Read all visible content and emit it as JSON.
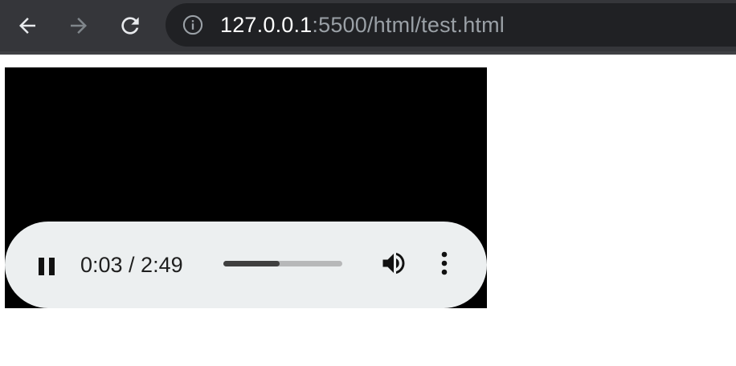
{
  "browser": {
    "nav": {
      "back_icon": "arrow-left-icon",
      "forward_icon": "arrow-right-icon",
      "reload_icon": "reload-icon"
    },
    "address_bar": {
      "info_icon": "info-icon",
      "url_host": "127.0.0.1",
      "url_rest": ":5500/html/test.html"
    }
  },
  "video_player": {
    "state": "playing",
    "pause_icon": "pause-icon",
    "time_display": "0:03 / 2:49",
    "current_time": "0:03",
    "duration": "2:49",
    "progress_fraction": 0.47,
    "volume_icon": "speaker-icon",
    "more_icon": "more-vertical-icon"
  },
  "colors": {
    "toolbar": "#35363a",
    "omnibox": "#202124",
    "controls_bg": "#eceff0",
    "progress_track": "#b7b8b9",
    "progress_fill": "#3f3f3f"
  }
}
